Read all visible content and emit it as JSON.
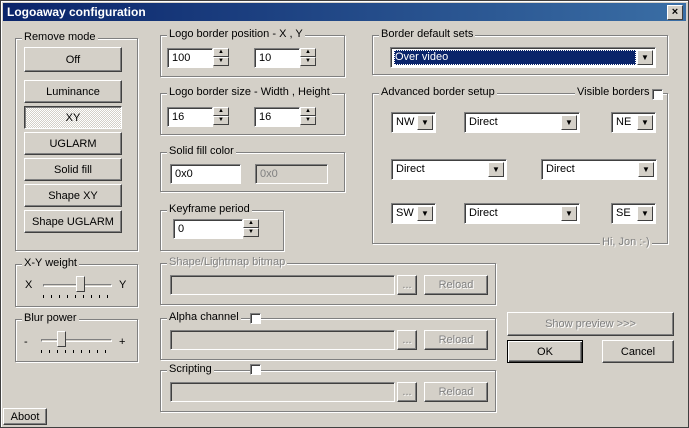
{
  "window": {
    "title": "Logoaway configuration",
    "close_glyph": "×"
  },
  "remove_mode": {
    "label": "Remove mode",
    "buttons": [
      "Off",
      "Luminance",
      "XY",
      "UGLARM",
      "Solid fill",
      "Shape XY",
      "Shape UGLARM"
    ],
    "selected": "XY"
  },
  "xy_weight": {
    "label": "X-Y weight",
    "left_label": "X",
    "right_label": "Y",
    "value": 0.55
  },
  "blur_power": {
    "label": "Blur power",
    "left_label": "-",
    "right_label": "+",
    "value": 0.25
  },
  "logo_position": {
    "label": "Logo border position - X , Y",
    "x": "100",
    "y": "10"
  },
  "logo_size": {
    "label": "Logo border size - Width , Height",
    "width": "16",
    "height": "16"
  },
  "solid_fill": {
    "label": "Solid fill color",
    "value": "0x0",
    "preview": "0x0"
  },
  "keyframe": {
    "label": "Keyframe period",
    "value": "0"
  },
  "shape_bitmap": {
    "label": "Shape/Lightmap bitmap",
    "path": "",
    "browse": "...",
    "reload": "Reload"
  },
  "alpha_channel": {
    "label": "Alpha channel",
    "path": "",
    "browse": "...",
    "reload": "Reload"
  },
  "scripting": {
    "label": "Scripting",
    "path": "",
    "browse": "...",
    "reload": "Reload"
  },
  "border_sets": {
    "label": "Border default sets",
    "value": "Over video"
  },
  "advanced": {
    "label": "Advanced border setup",
    "visible_borders_label": "Visible borders",
    "nw": "NW",
    "top": "Direct",
    "ne": "NE",
    "left": "Direct",
    "right": "Direct",
    "sw": "SW",
    "bottom": "Direct",
    "se": "SE",
    "signature": "Hi, Jon :-)"
  },
  "actions": {
    "show_preview": "Show preview >>>",
    "ok": "OK",
    "cancel": "Cancel",
    "about": "Aboot"
  }
}
